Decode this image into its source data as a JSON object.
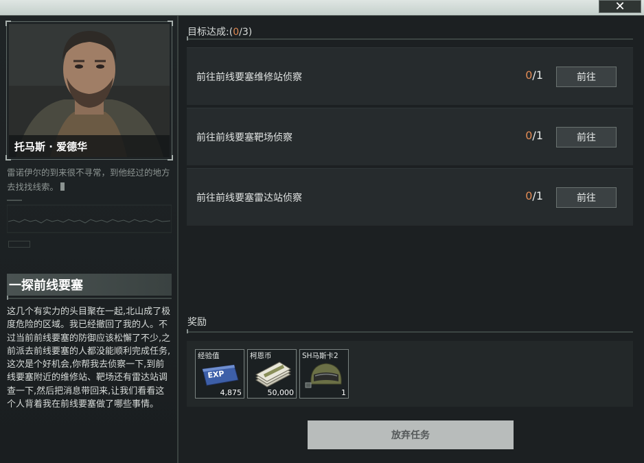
{
  "window": {
    "close_glyph": "✕"
  },
  "npc": {
    "name": "托马斯 · 爱德华",
    "quote": "雷诺伊尔的到来很不寻常，到他经过的地方去找找线索。"
  },
  "mission": {
    "title": "一探前线要塞",
    "description": "这几个有实力的头目聚在一起,北山成了极度危险的区域。我已经撤回了我的人。不过当前前线要塞的防御应该松懈了不少,之前派去前线要塞的人都没能顺利完成任务,这次是个好机会,你帮我去侦察一下,到前线要塞附近的维修站、靶场还有雷达站调查一下,然后把消息带回来,让我们看看这个人背着我在前线要塞做了哪些事情。"
  },
  "objectives": {
    "header_prefix": "目标达成:(",
    "done": "0",
    "header_sep": "/",
    "total": "3",
    "header_suffix": ")",
    "items": [
      {
        "label": "前往前线要塞维修站侦察",
        "current": "0",
        "target": "/1",
        "button": "前往"
      },
      {
        "label": "前往前线要塞靶场侦察",
        "current": "0",
        "target": "/1",
        "button": "前往"
      },
      {
        "label": "前往前线要塞雷达站侦察",
        "current": "0",
        "target": "/1",
        "button": "前往"
      }
    ]
  },
  "rewards": {
    "header": "奖励",
    "items": [
      {
        "name": "经验值",
        "qty": "4,875",
        "icon": "exp-card-icon"
      },
      {
        "name": "柯恩币",
        "qty": "50,000",
        "icon": "cash-stack-icon"
      },
      {
        "name": "SH马斯卡2",
        "qty": "1",
        "icon": "helmet-icon"
      }
    ]
  },
  "actions": {
    "abandon": "放弃任务"
  },
  "colors": {
    "accent_orange": "#e08a54",
    "panel": "#262b2d",
    "background": "#1c2022"
  }
}
